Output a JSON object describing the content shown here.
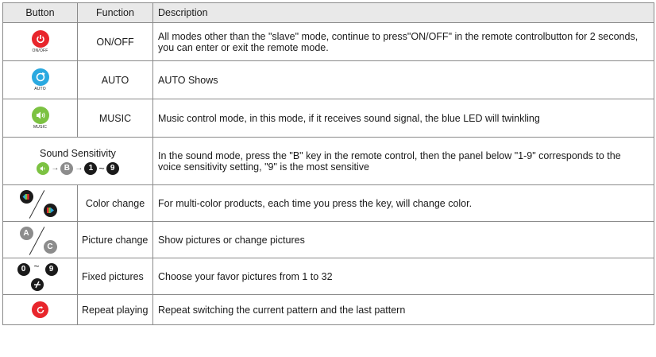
{
  "headers": {
    "button": "Button",
    "function": "Function",
    "description": "Description"
  },
  "rows": [
    {
      "function": "ON/OFF",
      "description": "All modes other than the \"slave\" mode, continue to press\"ON/OFF\" in the remote controlbutton for 2 seconds, you can enter or exit the remote mode.",
      "icon_label": "ON/OFF"
    },
    {
      "function": "AUTO",
      "description": "AUTO Shows",
      "icon_label": "AUTO"
    },
    {
      "function": "MUSIC",
      "description": "Music control mode, in this mode, if it receives sound signal, the blue LED will twinkling",
      "icon_label": "MUSIC"
    },
    {
      "function": "",
      "button_title": "Sound Sensitivity",
      "description": "In the sound mode, press the \"B\" key in the remote control, then the panel below \"1-9\" corresponds to the voice sensitivity setting, \"9\" is the most sensitive",
      "seq": {
        "b": "B",
        "one": "1",
        "tilde": "~",
        "nine": "9"
      }
    },
    {
      "function": "Color  change",
      "description": "For multi-color products, each time you press the key, will change color."
    },
    {
      "function": "Picture  change",
      "description": "Show pictures or change pictures",
      "keys": {
        "a": "A",
        "c": "C"
      }
    },
    {
      "function": "Fixed pictures",
      "description": "Choose your favor pictures from 1 to 32",
      "keys": {
        "zero": "0",
        "tilde": "~",
        "nine": "9"
      }
    },
    {
      "function": "Repeat  playing",
      "description": "Repeat switching the current pattern and the last pattern"
    }
  ],
  "colors": {
    "red": "#e8262c",
    "cyan": "#2aa9e0",
    "green": "#7cc242",
    "gray": "#8c8c8c",
    "black": "#1a1a1a"
  }
}
